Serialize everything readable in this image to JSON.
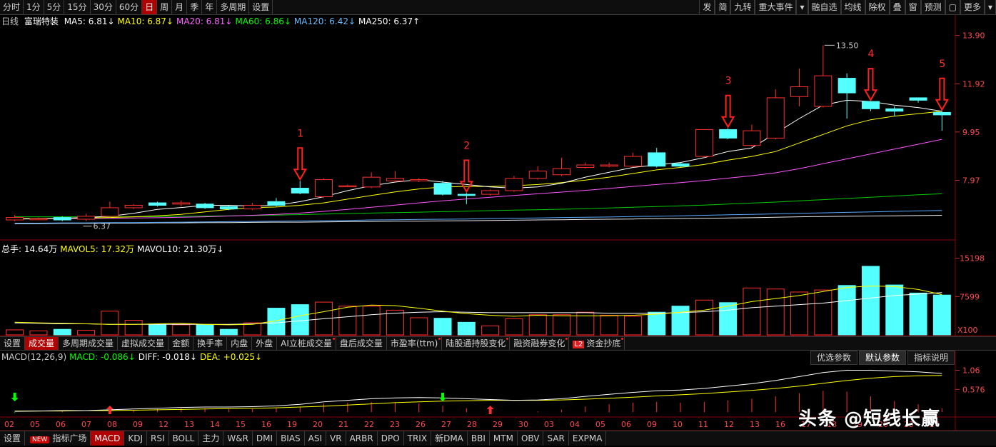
{
  "toolbar": {
    "left": [
      "分时",
      "1分",
      "5分",
      "15分",
      "30分",
      "60分",
      "日",
      "周",
      "月",
      "季",
      "年",
      "多周期",
      "设置"
    ],
    "active": "日",
    "right": [
      "发",
      "简",
      "九转",
      "重大事件",
      "▾",
      "融自选",
      "均线",
      "除权",
      "叠",
      "窗",
      "预测",
      "▢",
      "更多",
      "▾"
    ]
  },
  "legend": {
    "period": "日线",
    "stock": "富瑞特装",
    "items": [
      {
        "text": "MA5: 6.81↓",
        "color": "#ffffff"
      },
      {
        "text": "MA10: 6.87↓",
        "color": "#ffff00"
      },
      {
        "text": "MA20: 6.81↓",
        "color": "#ff66ff"
      },
      {
        "text": "MA60: 6.86↓",
        "color": "#00ff00"
      },
      {
        "text": "MA120: 6.42↓",
        "color": "#66bbff"
      },
      {
        "text": "MA250: 6.37↑",
        "color": "#ffffff"
      }
    ]
  },
  "price_axis": [
    "13.90",
    "11.92",
    "9.95",
    "7.97"
  ],
  "high_label": "13.50",
  "low_label": "6.37",
  "annotations": [
    "1",
    "2",
    "3",
    "4",
    "5"
  ],
  "volume_legend": {
    "items": [
      {
        "text": "总手: 14.64万",
        "color": "#ffffff"
      },
      {
        "text": "MAVOL5: 17.32万",
        "color": "#ffff00"
      },
      {
        "text": "MAVOL10: 21.30万↓",
        "color": "#ffffff"
      }
    ]
  },
  "volume_axis": [
    "15198",
    "7599"
  ],
  "volume_unit": "X100",
  "indicator_tabs": [
    {
      "label": "设置"
    },
    {
      "label": "成交量",
      "active": true
    },
    {
      "label": "多周期成交量"
    },
    {
      "label": "虚拟成交量"
    },
    {
      "label": "金额"
    },
    {
      "label": "换手率"
    },
    {
      "label": "内盘"
    },
    {
      "label": "外盘"
    },
    {
      "label": "AI立桩成交量",
      "dot": true
    },
    {
      "label": "盘后成交量"
    },
    {
      "label": "市盈率(ttm)",
      "dot": true
    },
    {
      "label": "陆股通持股变化",
      "dot": true
    },
    {
      "label": "融资融券变化",
      "dot": true
    },
    {
      "label": "资金抄底",
      "l2": true,
      "dot": true
    }
  ],
  "macd_legend": {
    "items": [
      {
        "text": "MACD(12,26,9)",
        "color": "#c8c8c8"
      },
      {
        "text": "MACD: -0.086↓",
        "color": "#00ff00"
      },
      {
        "text": "DIFF: -0.018↓",
        "color": "#ffffff"
      },
      {
        "text": "DEA: +0.025↓",
        "color": "#ffff00"
      }
    ]
  },
  "macd_buttons": [
    "优选参数",
    "默认参数",
    "指标说明"
  ],
  "macd_axis": [
    "1.06",
    "0.576"
  ],
  "date_axis": [
    "02",
    "05",
    "06",
    "07",
    "08",
    "09",
    "12",
    "13",
    "14",
    "15",
    "16",
    "19",
    "20",
    "21",
    "22",
    "23",
    "26",
    "27",
    "28",
    "29",
    "30",
    "03",
    "04",
    "05",
    "06",
    "09",
    "10",
    "11",
    "12",
    "13",
    "16",
    "17",
    "18",
    "19",
    "20",
    "23",
    "24"
  ],
  "bottom_tabs": [
    {
      "label": "设置"
    },
    {
      "label": "指标广场",
      "new": true
    },
    {
      "label": "MACD",
      "active": true
    },
    {
      "label": "KDJ"
    },
    {
      "label": "RSI"
    },
    {
      "label": "BOLL"
    },
    {
      "label": "主力"
    },
    {
      "label": "W&R"
    },
    {
      "label": "DMI"
    },
    {
      "label": "BIAS"
    },
    {
      "label": "ASI"
    },
    {
      "label": "VR"
    },
    {
      "label": "ARBR"
    },
    {
      "label": "DPO"
    },
    {
      "label": "TRIX"
    },
    {
      "label": "新DMA"
    },
    {
      "label": "BBI"
    },
    {
      "label": "MTM"
    },
    {
      "label": "OBV"
    },
    {
      "label": "SAR"
    },
    {
      "label": "EXPMA"
    }
  ],
  "new_badge": "NEW",
  "watermark": "头条 @短线长赢",
  "chart_data": {
    "type": "candlestick",
    "candles": [
      [
        6.35,
        6.45,
        6.3,
        6.55
      ],
      [
        6.4,
        6.4,
        6.35,
        6.45
      ],
      [
        6.45,
        6.35,
        6.3,
        6.5
      ],
      [
        6.38,
        6.5,
        6.3,
        6.6
      ],
      [
        6.5,
        6.85,
        6.45,
        7.1
      ],
      [
        6.85,
        6.95,
        6.8,
        7.0
      ],
      [
        7.05,
        6.95,
        6.9,
        7.1
      ],
      [
        7.0,
        7.05,
        6.9,
        7.15
      ],
      [
        7.0,
        6.85,
        6.8,
        7.05
      ],
      [
        6.9,
        6.8,
        6.75,
        6.95
      ],
      [
        6.8,
        6.95,
        6.75,
        7.05
      ],
      [
        7.1,
        6.95,
        6.9,
        7.25
      ],
      [
        7.65,
        7.45,
        7.4,
        7.95
      ],
      [
        7.3,
        8.0,
        7.25,
        8.05
      ],
      [
        7.75,
        7.75,
        7.7,
        7.8
      ],
      [
        7.7,
        8.1,
        7.65,
        8.3
      ],
      [
        7.95,
        8.05,
        7.9,
        8.35
      ],
      [
        7.95,
        8.0,
        7.9,
        8.05
      ],
      [
        7.85,
        7.4,
        7.35,
        7.95
      ],
      [
        7.4,
        7.35,
        7.0,
        7.45
      ],
      [
        7.4,
        7.55,
        7.35,
        7.6
      ],
      [
        7.55,
        8.05,
        7.5,
        8.15
      ],
      [
        8.05,
        8.35,
        8.0,
        8.55
      ],
      [
        8.2,
        8.45,
        8.15,
        8.9
      ],
      [
        8.5,
        8.6,
        8.45,
        8.7
      ],
      [
        8.55,
        8.6,
        8.5,
        8.7
      ],
      [
        8.55,
        8.95,
        8.5,
        9.1
      ],
      [
        9.1,
        8.55,
        8.5,
        9.3
      ],
      [
        8.65,
        8.55,
        8.5,
        8.7
      ],
      [
        8.95,
        10.05,
        8.9,
        10.05
      ],
      [
        10.05,
        9.7,
        9.65,
        10.1
      ],
      [
        9.4,
        10.0,
        9.35,
        10.25
      ],
      [
        9.7,
        11.35,
        9.65,
        11.7
      ],
      [
        11.4,
        11.8,
        11.0,
        12.55
      ],
      [
        11.0,
        12.25,
        10.95,
        13.5
      ],
      [
        12.15,
        11.55,
        10.5,
        12.35
      ],
      [
        11.2,
        10.9,
        10.8,
        11.2
      ],
      [
        10.9,
        10.8,
        10.6,
        11.0
      ],
      [
        11.35,
        11.25,
        11.15,
        11.35
      ],
      [
        10.75,
        10.65,
        10.0,
        10.8
      ]
    ],
    "ma5": [
      6.38,
      6.4,
      6.42,
      6.45,
      6.5,
      6.62,
      6.78,
      6.86,
      6.95,
      6.95,
      6.92,
      6.95,
      7.1,
      7.3,
      7.55,
      7.75,
      7.9,
      8.0,
      7.9,
      7.8,
      7.7,
      7.65,
      7.7,
      7.85,
      8.1,
      8.3,
      8.5,
      8.6,
      8.7,
      8.9,
      9.15,
      9.3,
      9.9,
      10.5,
      11.05,
      11.25,
      11.2,
      11.05,
      10.95,
      10.8
    ],
    "ma10": [
      6.4,
      6.41,
      6.42,
      6.43,
      6.45,
      6.48,
      6.52,
      6.58,
      6.68,
      6.78,
      6.85,
      6.88,
      6.95,
      7.05,
      7.2,
      7.35,
      7.5,
      7.62,
      7.7,
      7.72,
      7.72,
      7.75,
      7.8,
      7.88,
      7.98,
      8.1,
      8.25,
      8.4,
      8.5,
      8.62,
      8.8,
      8.95,
      9.15,
      9.5,
      9.85,
      10.2,
      10.45,
      10.6,
      10.7,
      10.8
    ],
    "ma20": [
      6.4,
      6.4,
      6.41,
      6.41,
      6.42,
      6.43,
      6.44,
      6.46,
      6.48,
      6.51,
      6.54,
      6.58,
      6.63,
      6.7,
      6.78,
      6.87,
      6.96,
      7.05,
      7.13,
      7.21,
      7.28,
      7.35,
      7.42,
      7.49,
      7.56,
      7.64,
      7.72,
      7.8,
      7.88,
      7.96,
      8.06,
      8.16,
      8.28,
      8.45,
      8.65,
      8.85,
      9.05,
      9.25,
      9.45,
      9.65
    ],
    "ma60": [
      6.48,
      6.48,
      6.48,
      6.48,
      6.48,
      6.48,
      6.49,
      6.5,
      6.51,
      6.52,
      6.53,
      6.55,
      6.57,
      6.59,
      6.61,
      6.63,
      6.65,
      6.67,
      6.69,
      6.71,
      6.73,
      6.75,
      6.77,
      6.79,
      6.81,
      6.84,
      6.87,
      6.9,
      6.93,
      6.96,
      7.0,
      7.04,
      7.08,
      7.13,
      7.18,
      7.23,
      7.28,
      7.33,
      7.38,
      7.42
    ],
    "ma120": [
      6.22,
      6.22,
      6.23,
      6.23,
      6.24,
      6.24,
      6.25,
      6.26,
      6.27,
      6.28,
      6.29,
      6.3,
      6.31,
      6.32,
      6.33,
      6.35,
      6.36,
      6.37,
      6.38,
      6.39,
      6.41,
      6.42,
      6.43,
      6.45,
      6.46,
      6.47,
      6.49,
      6.5,
      6.52,
      6.54,
      6.56,
      6.58,
      6.6,
      6.62,
      6.64,
      6.66,
      6.68,
      6.7,
      6.72,
      6.74
    ],
    "ma250": [
      6.2,
      6.2,
      6.21,
      6.21,
      6.22,
      6.22,
      6.23,
      6.23,
      6.24,
      6.24,
      6.25,
      6.26,
      6.26,
      6.27,
      6.28,
      6.29,
      6.3,
      6.3,
      6.31,
      6.32,
      6.33,
      6.34,
      6.35,
      6.36,
      6.37,
      6.38,
      6.39,
      6.4,
      6.41,
      6.42,
      6.43,
      6.44,
      6.46,
      6.48,
      6.49,
      6.5,
      6.51,
      6.52,
      6.53,
      6.54
    ],
    "volume": [
      1000,
      800,
      1100,
      900,
      4700,
      2900,
      2100,
      2000,
      2000,
      1100,
      2400,
      5300,
      6000,
      6500,
      5700,
      5700,
      4900,
      3400,
      3300,
      2500,
      1800,
      3200,
      4000,
      4000,
      4500,
      3900,
      3700,
      4500,
      5700,
      6900,
      6400,
      9300,
      9100,
      8500,
      8900,
      9800,
      13600,
      9900,
      8300,
      7900
    ],
    "mavol5": [
      2500,
      2400,
      2300,
      2200,
      2100,
      2100,
      2200,
      2300,
      2100,
      2000,
      2100,
      2800,
      3800,
      4600,
      5500,
      5900,
      5800,
      5300,
      4700,
      4200,
      3900,
      3700,
      3900,
      3800,
      3800,
      3800,
      3900,
      4100,
      4500,
      4900,
      5700,
      6600,
      7200,
      7800,
      8600,
      9400,
      9700,
      9600,
      9000,
      8000
    ],
    "mavol10": [
      2400,
      2300,
      2200,
      2200,
      2100,
      2100,
      2100,
      2100,
      2100,
      2100,
      2200,
      2400,
      2800,
      3200,
      3600,
      4000,
      4300,
      4500,
      4600,
      4500,
      4400,
      4400,
      4400,
      4400,
      4400,
      4300,
      4300,
      4300,
      4400,
      4600,
      4900,
      5400,
      5700,
      6000,
      6300,
      6800,
      7300,
      7800,
      8100,
      8400
    ],
    "diff": [
      0.02,
      0.03,
      0.04,
      0.04,
      0.06,
      0.08,
      0.1,
      0.12,
      0.13,
      0.13,
      0.14,
      0.16,
      0.2,
      0.26,
      0.3,
      0.34,
      0.36,
      0.37,
      0.36,
      0.34,
      0.32,
      0.3,
      0.31,
      0.34,
      0.4,
      0.45,
      0.5,
      0.54,
      0.56,
      0.6,
      0.66,
      0.72,
      0.8,
      0.9,
      1.0,
      1.06,
      1.06,
      1.04,
      1.02,
      0.98
    ],
    "dea": [
      0.03,
      0.03,
      0.03,
      0.04,
      0.04,
      0.05,
      0.06,
      0.07,
      0.08,
      0.09,
      0.1,
      0.11,
      0.13,
      0.15,
      0.18,
      0.21,
      0.24,
      0.26,
      0.28,
      0.29,
      0.3,
      0.3,
      0.3,
      0.31,
      0.33,
      0.35,
      0.38,
      0.41,
      0.44,
      0.47,
      0.51,
      0.55,
      0.6,
      0.66,
      0.73,
      0.8,
      0.86,
      0.9,
      0.92,
      0.93
    ],
    "price_range": [
      6.0,
      14.3
    ],
    "volume_range": [
      0,
      16000
    ],
    "macd_range": [
      -0.05,
      1.25
    ]
  }
}
